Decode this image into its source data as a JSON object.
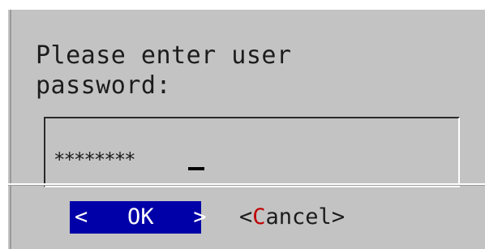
{
  "dialog": {
    "prompt_line1": "Please enter user",
    "prompt_line2": "password:",
    "password": {
      "masked_value": "********",
      "cursor": "_"
    },
    "buttons": {
      "ok": {
        "left_bracket": "<",
        "hotkey": "O",
        "rest": "K",
        "right_bracket": ">",
        "selected": true
      },
      "cancel": {
        "left_bracket": "<",
        "hotkey": "C",
        "rest": "ancel",
        "right_bracket": ">",
        "selected": false
      }
    }
  },
  "colors": {
    "dialog_bg": "#c3c3c3",
    "selected_button_bg": "#0000a8",
    "selected_button_fg": "#ffffff",
    "hotkey": "#c00000",
    "text": "#1c1c1c"
  }
}
